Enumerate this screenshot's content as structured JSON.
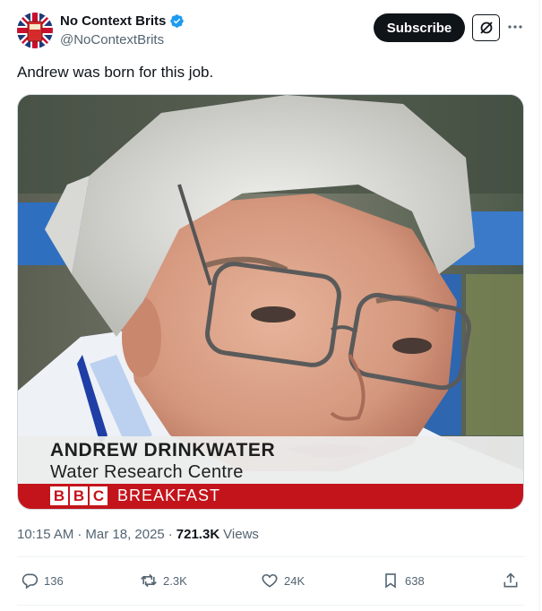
{
  "author": {
    "name": "No Context Brits",
    "handle": "@NoContextBrits",
    "verified": true,
    "avatar_icon": "union-jack-avatar"
  },
  "header": {
    "subscribe_label": "Subscribe",
    "grok_icon": "grok-icon",
    "more_icon": "more-icon"
  },
  "tweet": {
    "text": "Andrew was born for this job."
  },
  "media": {
    "lower_third_name": "ANDREW DRINKWATER",
    "lower_third_org": "Water Research Centre",
    "bbc_letters": [
      "B",
      "B",
      "C"
    ],
    "programme": "BREAKFAST"
  },
  "meta": {
    "time": "10:15 AM",
    "date": "Mar 18, 2025",
    "views_count": "721.3K",
    "views_label": "Views"
  },
  "actions": {
    "replies": "136",
    "reposts": "2.3K",
    "likes": "24K",
    "bookmarks": "638"
  },
  "colors": {
    "text_primary": "#0f1419",
    "text_secondary": "#536471",
    "verified_blue": "#1d9bf0",
    "bbc_red": "#c4141b"
  }
}
